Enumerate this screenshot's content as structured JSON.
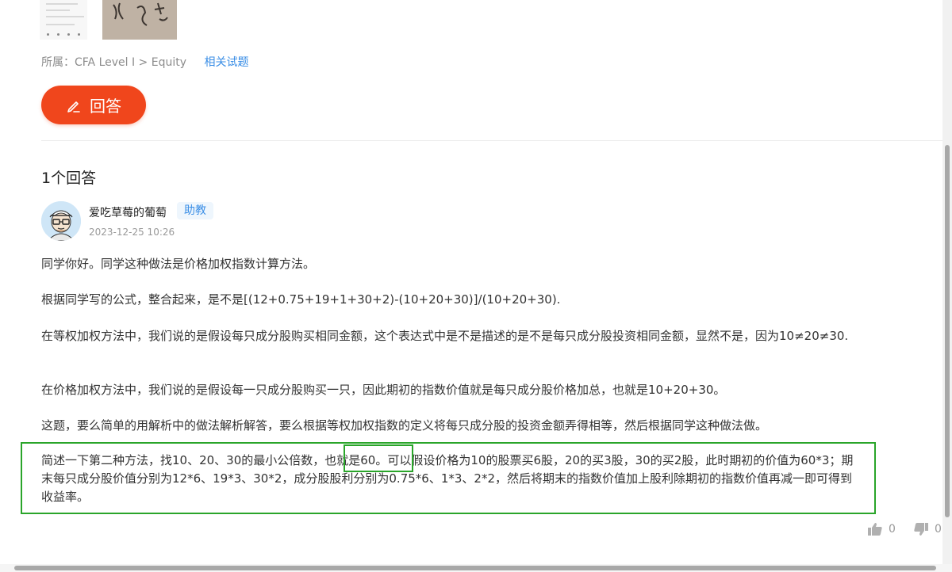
{
  "breadcrumb": {
    "prefix": "所属：CFA Level I > Equity",
    "related_link": "相关试题"
  },
  "answer_button": {
    "label": "回答",
    "icon": "pencil-icon",
    "color": "#f0461c"
  },
  "answers": {
    "count_label": "1个回答"
  },
  "answer_post": {
    "user_name": "爱吃草莓的葡萄",
    "role": "助教",
    "timestamp": "2023-12-25 10:26",
    "paragraphs": [
      "同学你好。同学这种做法是价格加权指数计算方法。",
      "根据同学写的公式，整合起来，是不是[(12+0.75+19+1+30+2)-(10+20+30)]/(10+20+30).",
      "在等权加权方法中，我们说的是假设每只成分股购买相同金额，这个表达式中是不是描述的是不是每只成分股投资相同金额，显然不是，因为10≠20≠30.",
      "在价格加权方法中，我们说的是假设每一只成分股购买一只，因此期初的指数价值就是每只成分股价格加总，也就是10+20+30。",
      "这题，要么简单的用解析中的做法解析解答，要么根据等权加权指数的定义将每只成分股的投资金额弄得相等，然后根据同学这种做法做。",
      "简述一下第二种方法，找10、20、30的最小公倍数，也就是60。可以假设价格为10的股票买6股，20的买3股，30的买2股，此时期初的价值为60*3；期末每只成分股价值分别为12*6、19*3、30*2，成分股股利分别为0.75*6、1*3、2*2，然后将期末的指数价值加上股利除期初的指数价值再减一即可得到收益率。"
    ],
    "likes": "0",
    "dislikes": "0"
  },
  "colors": {
    "accent_blue": "#3a8ee6",
    "highlight_green": "#2aa52a"
  }
}
